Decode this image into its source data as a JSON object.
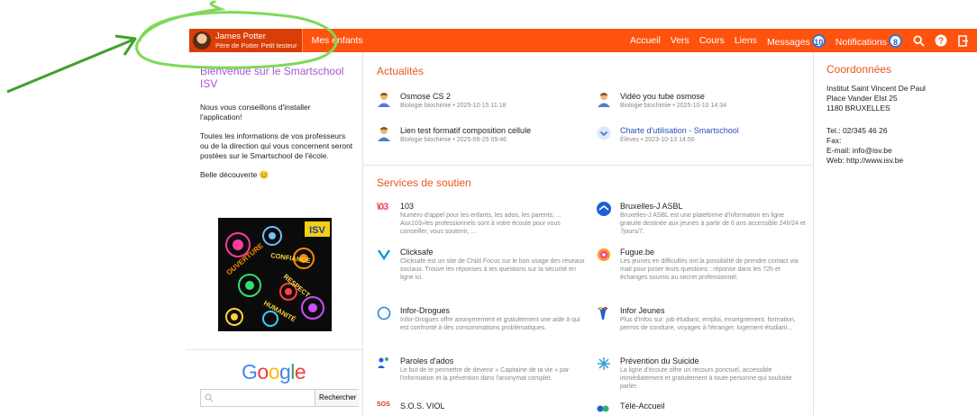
{
  "topbar": {
    "user_name": "James Potter",
    "user_sub": "Père de Potter Petit testeur",
    "children_label": "Mes enfants",
    "nav": [
      "Accueil",
      "Vers",
      "Cours",
      "Liens"
    ],
    "messages_label": "Messages",
    "messages_count": "10",
    "notifications_label": "Notifications",
    "notifications_count": "8",
    "accent": "#ff520e"
  },
  "left": {
    "welcome": "Bienvenue sur le Smartschool ISV",
    "p1": "Nous vous conseillons d'installer l'application!",
    "p2": "Toutes les informations de vos professeurs ou de la direction qui vous concernent seront postées sur le Smartschool de l'école.",
    "p3": "Belle découverte 😊",
    "poster": {
      "logo": "ISV",
      "words": [
        "OUVERTURE",
        "CONFIANCE",
        "RESPECT",
        "HUMANITÉ"
      ]
    },
    "google": "Google",
    "search_placeholder": "",
    "search_button": "Rechercher"
  },
  "news": {
    "title": "Actualités",
    "items": [
      {
        "title": "Osmose CS 2",
        "meta": "Biologie biochimie • 2025-10-15 11:18"
      },
      {
        "title": "Vidéo you tube osmose",
        "meta": "Biologie biochimie • 2025-10-10 14:34"
      },
      {
        "title": "Lien test formatif composition cellule",
        "meta": "Biologie biochimie • 2025-09-25 09:46"
      },
      {
        "title": "Charte d'utilisation - Smartschool",
        "meta": "Élèves • 2023-10-13 14:50"
      }
    ]
  },
  "services": {
    "title": "Services de soutien",
    "items": [
      {
        "title": "103",
        "desc": "Numéro d'appel pour les enfants, les ados, les parents, ... Aux103»les professionnels sont à votre écoute pour vous conseiller, vous soutenir, ..."
      },
      {
        "title": "Bruxelles-J ASBL",
        "desc": "Bruxelles-J ASBL est une plateforme d'information en ligne gratuite destinée aux jeunes à partir de 6 ans accessible 24h/24 et 7jours/7."
      },
      {
        "title": "Clicksafe",
        "desc": "Clicksafe est un site de Child Focus sur le bon usage des réseaux sociaux. Trouve les réponses à tes questions sur la sécurité en ligne ici."
      },
      {
        "title": "Fugue.be",
        "desc": "Les jeunes en difficultés ont la possibilité de prendre contact via mail pour poser leurs questions : réponse dans les 72h et échanges soumis au secret professionnel."
      },
      {
        "title": "Infor-Drogues",
        "desc": "Infor-Drogues offre anonymement et gratuitement une aide à qui est confronté à des consommations problématiques."
      },
      {
        "title": "Infor Jeunes",
        "desc": "Plus d'infos sur: job étudiant, emploi, enseignement, formation, permis de conduire, voyages à l'étranger, logement étudiant..."
      },
      {
        "title": "Paroles d'ados",
        "desc": "Le but de te permettre de devenir « Capitaine de ta vie » par l'information et la prévention dans l'anonymat complet."
      },
      {
        "title": "Prévention du Suicide",
        "desc": "La ligne d'écoute offre un recours ponctuel, accessible immédiatement et gratuitement à toute personne qui souhaite parler."
      },
      {
        "title": "S.O.S. VIOL",
        "desc": ""
      },
      {
        "title": "Télé-Accueil",
        "desc": ""
      }
    ]
  },
  "coords": {
    "title": "Coordonnées",
    "name": "Institut Saint Vincent De Paul",
    "street": "Place Vander Elst 25",
    "city": "1180 BRUXELLES",
    "tel": "Tel.: 02/345 46 26",
    "fax": "Fax:",
    "email": "E-mail: info@isv.be",
    "web": "Web: http://www.isv.be"
  }
}
